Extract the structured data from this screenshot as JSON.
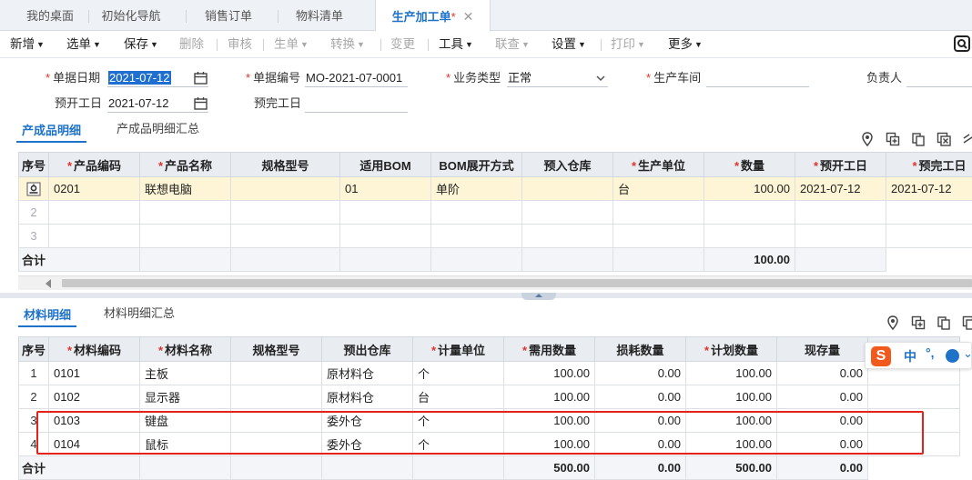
{
  "tabs": [
    {
      "label": "我的桌面"
    },
    {
      "label": "初始化导航"
    },
    {
      "label": "销售订单"
    },
    {
      "label": "物料清单"
    },
    {
      "label": "生产加工单",
      "modified_mark": "*",
      "close": "✕"
    }
  ],
  "toolbar": {
    "new": "新增",
    "select": "选单",
    "save": "保存",
    "delete": "删除",
    "audit": "审核",
    "generate": "生单",
    "convert": "转换",
    "change": "变更",
    "tools": "工具",
    "link": "联查",
    "settings": "设置",
    "print": "打印",
    "more": "更多"
  },
  "header": {
    "doc_date_label": "单据日期",
    "doc_date_value": "2021-07-12",
    "doc_no_label": "单据编号",
    "doc_no_value": "MO-2021-07-0001",
    "biz_type_label": "业务类型",
    "biz_type_value": "正常",
    "workshop_label": "生产车间",
    "workshop_value": "",
    "owner_label": "负责人",
    "owner_value": "",
    "plan_start_label": "预开工日",
    "plan_start_value": "2021-07-12",
    "plan_finish_label": "预完工日",
    "plan_finish_value": ""
  },
  "product_tabs": {
    "detail": "产成品明细",
    "summary": "产成品明细汇总"
  },
  "product_table": {
    "columns": [
      "序号",
      "产品编码",
      "产品名称",
      "规格型号",
      "适用BOM",
      "BOM展开方式",
      "预入仓库",
      "生产单位",
      "数量",
      "预开工日",
      "预完工日"
    ],
    "required": [
      false,
      true,
      true,
      false,
      false,
      false,
      false,
      true,
      true,
      true,
      true
    ],
    "rows": [
      {
        "idx": "",
        "code": "0201",
        "name": "联想电脑",
        "spec": "",
        "bom": "01",
        "expand": "单阶",
        "warehouse": "",
        "unit": "台",
        "qty": "100.00",
        "start": "2021-07-12",
        "finish": "2021-07-12"
      },
      {
        "idx": "2",
        "code": "",
        "name": "",
        "spec": "",
        "bom": "",
        "expand": "",
        "warehouse": "",
        "unit": "",
        "qty": "",
        "start": "",
        "finish": ""
      },
      {
        "idx": "3",
        "code": "",
        "name": "",
        "spec": "",
        "bom": "",
        "expand": "",
        "warehouse": "",
        "unit": "",
        "qty": "",
        "start": "",
        "finish": ""
      }
    ],
    "total_label": "合计",
    "total_qty": "100.00"
  },
  "material_tabs": {
    "detail": "材料明细",
    "summary": "材料明细汇总"
  },
  "material_table": {
    "columns": [
      "序号",
      "材料编码",
      "材料名称",
      "规格型号",
      "预出仓库",
      "计量单位",
      "需用数量",
      "损耗数量",
      "计划数量",
      "现存量"
    ],
    "required": [
      false,
      true,
      true,
      false,
      false,
      true,
      true,
      false,
      true,
      false
    ],
    "rows": [
      {
        "idx": "1",
        "code": "0101",
        "name": "主板",
        "spec": "",
        "warehouse": "原材料仓",
        "unit": "个",
        "need": "100.00",
        "loss": "0.00",
        "plan": "100.00",
        "stock": "0.00"
      },
      {
        "idx": "2",
        "code": "0102",
        "name": "显示器",
        "spec": "",
        "warehouse": "原材料仓",
        "unit": "台",
        "need": "100.00",
        "loss": "0.00",
        "plan": "100.00",
        "stock": "0.00"
      },
      {
        "idx": "3",
        "code": "0103",
        "name": "键盘",
        "spec": "",
        "warehouse": "委外仓",
        "unit": "个",
        "need": "100.00",
        "loss": "0.00",
        "plan": "100.00",
        "stock": "0.00"
      },
      {
        "idx": "4",
        "code": "0104",
        "name": "鼠标",
        "spec": "",
        "warehouse": "委外仓",
        "unit": "个",
        "need": "100.00",
        "loss": "0.00",
        "plan": "100.00",
        "stock": "0.00"
      }
    ],
    "total_label": "合计",
    "total_need": "500.00",
    "total_loss": "0.00",
    "total_plan": "500.00",
    "total_stock": "0.00"
  },
  "ime": {
    "logo": "S",
    "mode": "中",
    "punct": "°,",
    "more": "⌄"
  },
  "colors": {
    "accent": "#1e73c8",
    "required": "#e0322b",
    "highlight_box": "#e3221b",
    "selected_row": "#fdf5d5"
  }
}
